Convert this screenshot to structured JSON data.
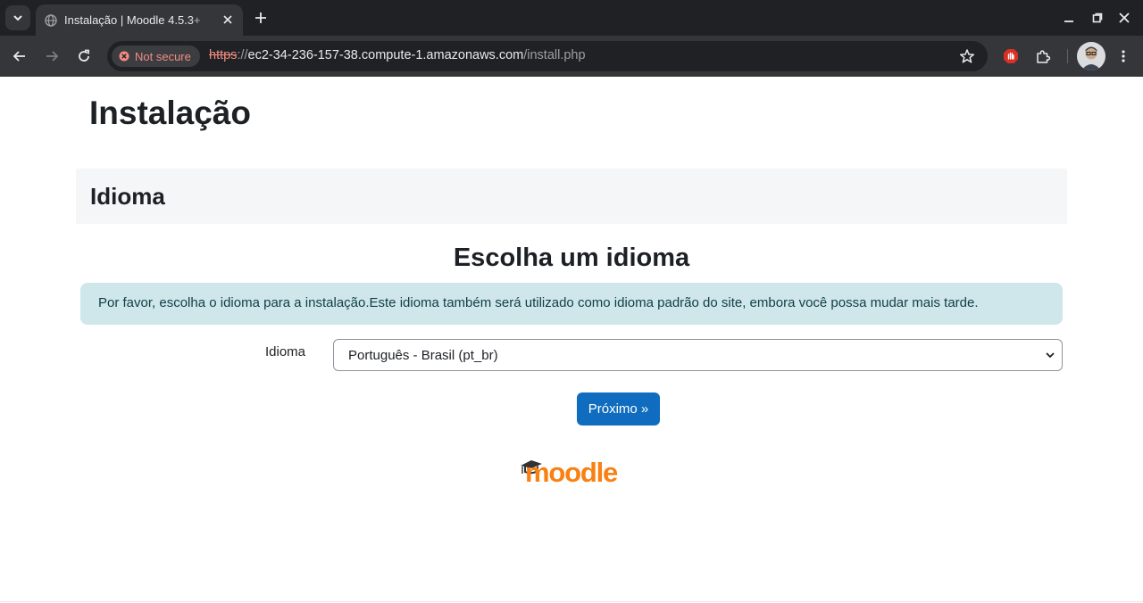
{
  "browser": {
    "tab_title": "Instalação | Moodle 4.5.3+",
    "security_label": "Not secure",
    "url_scheme": "https",
    "url_sep": "://",
    "url_host": "ec2-34-236-157-38.compute-1.amazonaws.com",
    "url_path": "/install.php",
    "icons": [
      "chevron-down-icon",
      "globe-icon",
      "close-icon",
      "plus-icon",
      "minimize-icon",
      "restore-icon",
      "back-icon",
      "forward-icon",
      "reload-icon",
      "warning-icon",
      "star-icon",
      "extension-icon",
      "puzzle-icon",
      "avatar",
      "kebab-menu-icon"
    ]
  },
  "page": {
    "title": "Instalação",
    "section_title": "Idioma",
    "heading": "Escolha um idioma",
    "info": "Por favor, escolha o idioma para a instalação.Este idioma também será utilizado como idioma padrão do site, embora você possa mudar mais tarde.",
    "language_label": "Idioma",
    "language_selected": "Português - Brasil (pt_br)",
    "next_button": "Próximo »",
    "logo_text": "moodle"
  },
  "colors": {
    "accent": "#0f6cbf",
    "alert_bg": "#cfe6ea",
    "brand_orange": "#f98012"
  }
}
